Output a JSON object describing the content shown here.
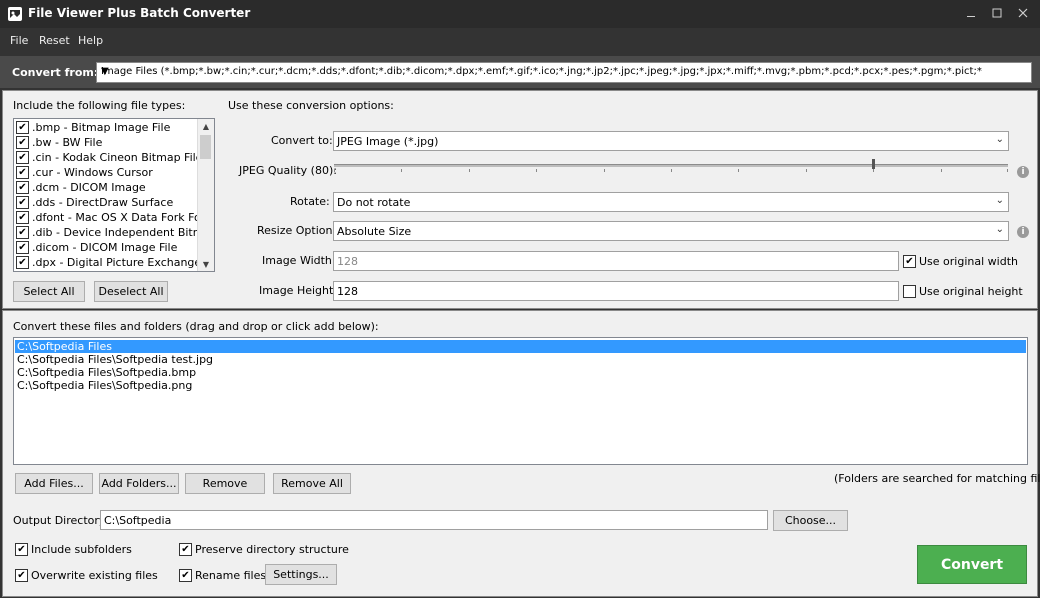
{
  "window": {
    "title": "File Viewer Plus Batch Converter"
  },
  "menu": {
    "items": [
      "File",
      "Reset",
      "Help"
    ]
  },
  "convert_from": {
    "label": "Convert from:",
    "value": "Image Files (*.bmp;*.bw;*.cin;*.cur;*.dcm;*.dds;*.dfont;*.dib;*.dicom;*.dpx;*.emf;*.gif;*.ico;*.jng;*.jp2;*.jpc;*.jpeg;*.jpg;*.jpx;*.miff;*.mvg;*.pbm;*.pcd;*.pcx;*.pes;*.pgm;*.pict;*"
  },
  "file_types": {
    "heading": "Include the following file types:",
    "items": [
      ".bmp - Bitmap Image File",
      ".bw - BW File",
      ".cin - Kodak Cineon Bitmap File",
      ".cur - Windows Cursor",
      ".dcm - DICOM Image",
      ".dds - DirectDraw Surface",
      ".dfont - Mac OS X Data Fork Font",
      ".dib - Device Independent Bitmap",
      ".dicom - DICOM Image File",
      ".dpx - Digital Picture Exchange File"
    ],
    "select_all": "Select All",
    "deselect_all": "Deselect All"
  },
  "options": {
    "heading": "Use these conversion options:",
    "convert_to_label": "Convert to:",
    "convert_to_value": "JPEG Image (*.jpg)",
    "quality_label": "JPEG Quality (80):",
    "quality_value": 80,
    "rotate_label": "Rotate:",
    "rotate_value": "Do not rotate",
    "resize_label": "Resize Option:",
    "resize_value": "Absolute Size",
    "width_label": "Image Width:",
    "width_value": "128",
    "use_original_width": "Use original width",
    "height_label": "Image Height:",
    "height_value": "128",
    "use_original_height": "Use original height"
  },
  "files": {
    "heading": "Convert these files and folders (drag and drop or click add below):",
    "items": [
      "C:\\Softpedia Files",
      "C:\\Softpedia Files\\Softpedia test.jpg",
      "C:\\Softpedia Files\\Softpedia.bmp",
      "C:\\Softpedia Files\\Softpedia.png"
    ],
    "add_files": "Add Files...",
    "add_folders": "Add Folders...",
    "remove": "Remove",
    "remove_all": "Remove All",
    "note": "(Folders are searched for matching files)"
  },
  "output": {
    "label": "Output Directory:",
    "value": "C:\\Softpedia",
    "choose": "Choose..."
  },
  "checkboxes": {
    "include_subfolders": "Include subfolders",
    "preserve_structure": "Preserve directory structure",
    "overwrite": "Overwrite existing files",
    "rename": "Rename files",
    "settings": "Settings..."
  },
  "convert_button": "Convert"
}
